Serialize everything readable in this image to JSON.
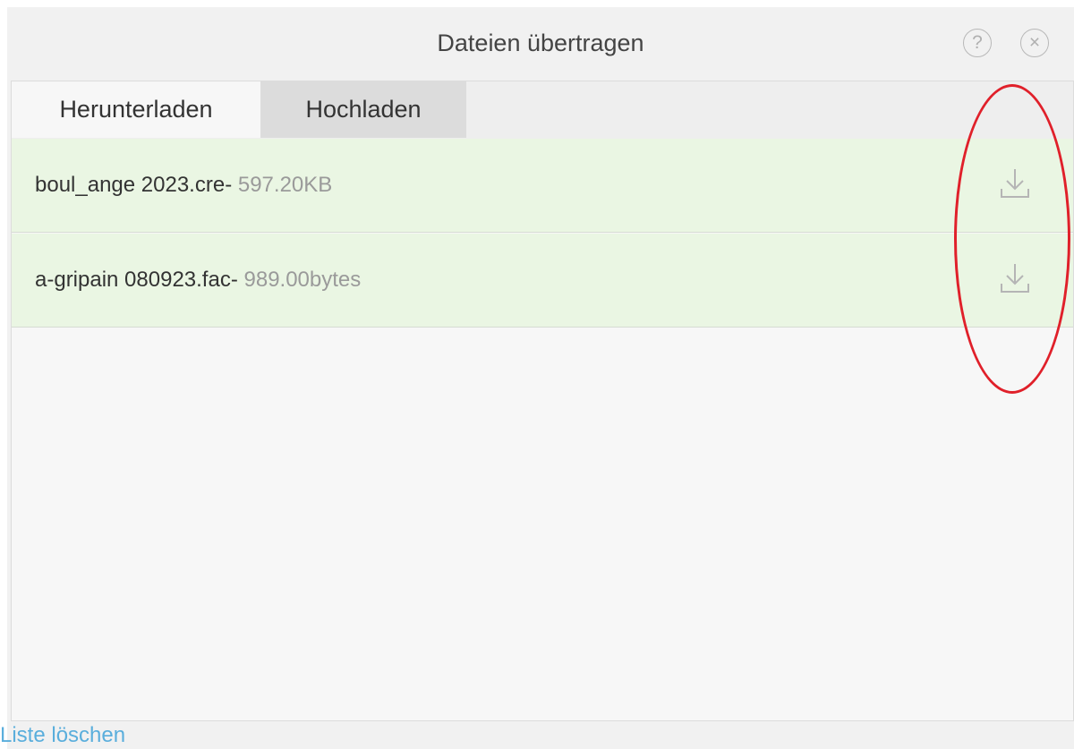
{
  "dialog": {
    "title": "Dateien übertragen",
    "help_label": "?",
    "close_label": "×"
  },
  "tabs": [
    {
      "label": "Herunterladen",
      "active": true
    },
    {
      "label": "Hochladen",
      "active": false
    }
  ],
  "files": [
    {
      "name": "boul_ange 2023.cre",
      "separator": "- ",
      "size": "597.20KB"
    },
    {
      "name": "a-gripain 080923.fac",
      "separator": "- ",
      "size": "989.00bytes"
    }
  ],
  "footer": {
    "clear_list": "Liste löschen"
  },
  "colors": {
    "row_background": "#eaf6e3",
    "link": "#5aaedc",
    "annotation": "#e0202a"
  },
  "icons": [
    "help-icon",
    "close-icon",
    "download-icon"
  ]
}
